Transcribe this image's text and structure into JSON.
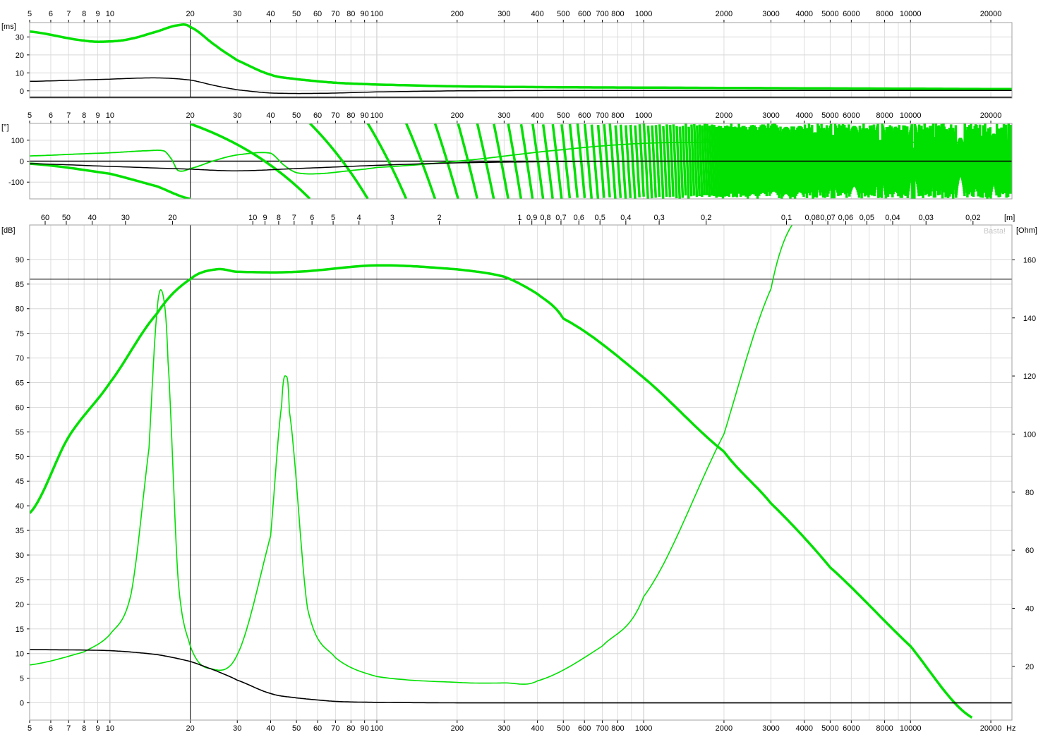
{
  "chart_data": [
    {
      "type": "line",
      "panel": "group-delay",
      "xscale": "log",
      "xlim": [
        5,
        24000
      ],
      "x_ticks": [
        "5",
        "6",
        "7",
        "8",
        "9",
        "10",
        "20",
        "30",
        "40",
        "50",
        "60",
        "70",
        "80",
        "90",
        "100",
        "200",
        "300",
        "400",
        "500",
        "600",
        "700",
        "800",
        "1000",
        "2000",
        "3000",
        "4000",
        "5000",
        "6000",
        "8000",
        "10000",
        "20000"
      ],
      "x_tick_values": [
        5,
        6,
        7,
        8,
        9,
        10,
        20,
        30,
        40,
        50,
        60,
        70,
        80,
        90,
        100,
        200,
        300,
        400,
        500,
        600,
        700,
        800,
        1000,
        2000,
        3000,
        4000,
        5000,
        6000,
        8000,
        10000,
        20000
      ],
      "unit": "[ms]",
      "ylim": [
        -4,
        38
      ],
      "y_ticks": [
        0,
        10,
        20,
        30
      ],
      "cursor_x": 20,
      "series": [
        {
          "style": "thick",
          "color": "#00e000",
          "x": [
            5,
            8,
            10,
            12,
            15,
            18,
            20,
            25,
            30,
            40,
            50,
            70,
            100,
            200,
            500,
            1000,
            3000,
            10000,
            24000
          ],
          "y": [
            33,
            28,
            27.5,
            29,
            33,
            36.5,
            35.5,
            25,
            17,
            9,
            6.5,
            4.5,
            3.5,
            2.5,
            2,
            1.8,
            1.5,
            1.2,
            1
          ]
        },
        {
          "style": "thin",
          "color": "#000000",
          "x": [
            5,
            10,
            15,
            20,
            25,
            30,
            40,
            60,
            100,
            200,
            500,
            24000
          ],
          "y": [
            5.3,
            6.5,
            7.2,
            6,
            2.8,
            0.6,
            -1.2,
            -1.4,
            -0.6,
            0,
            0.2,
            0.2
          ]
        }
      ]
    },
    {
      "type": "line",
      "panel": "phase",
      "xscale": "log",
      "xlim": [
        5,
        24000
      ],
      "x_ticks": [
        "5",
        "6",
        "7",
        "8",
        "9",
        "10",
        "20",
        "30",
        "40",
        "50",
        "60",
        "70",
        "80",
        "90",
        "100",
        "200",
        "300",
        "400",
        "500",
        "600",
        "700",
        "800",
        "1000",
        "2000",
        "3000",
        "4000",
        "5000",
        "6000",
        "8000",
        "10000",
        "20000"
      ],
      "x_tick_values": [
        5,
        6,
        7,
        8,
        9,
        10,
        20,
        30,
        40,
        50,
        60,
        70,
        80,
        90,
        100,
        200,
        300,
        400,
        500,
        600,
        700,
        800,
        1000,
        2000,
        3000,
        4000,
        5000,
        6000,
        8000,
        10000,
        20000
      ],
      "unit": "[°]",
      "ylim": [
        -180,
        180
      ],
      "y_ticks": [
        100,
        0,
        -100
      ],
      "cursor_x": 20,
      "series": [
        {
          "style": "thin",
          "color": "#00e000",
          "x": [
            5,
            8,
            10,
            14,
            16,
            17,
            18,
            20,
            25,
            30,
            40,
            45,
            50,
            60,
            80,
            100,
            200,
            500,
            1000,
            2000,
            24000
          ],
          "y": [
            25,
            35,
            40,
            50,
            48,
            10,
            -45,
            -35,
            5,
            30,
            38,
            -20,
            -55,
            -60,
            -45,
            -30,
            0,
            55,
            85,
            90,
            90
          ]
        },
        {
          "style": "thin",
          "color": "#000000",
          "x": [
            5,
            10,
            20,
            30,
            50,
            100,
            200,
            500,
            1000,
            24000
          ],
          "y": [
            -12,
            -25,
            -38,
            -46,
            -35,
            -20,
            -8,
            -2,
            0,
            0
          ]
        }
      ],
      "wrapped_phase": {
        "style": "thick",
        "color": "#00e000",
        "delay_ms": 0.0275,
        "phase_at_20hz": 178,
        "phase_below_cursor": [
          [
            5,
            -12
          ],
          [
            10,
            -60
          ],
          [
            15,
            -120
          ],
          [
            20,
            -180
          ]
        ]
      }
    },
    {
      "type": "line",
      "panel": "spl-impedance",
      "xscale": "log",
      "xlim": [
        5,
        24000
      ],
      "x_ticks": [
        "5",
        "6",
        "7",
        "8",
        "9",
        "10",
        "20",
        "30",
        "40",
        "50",
        "60",
        "70",
        "80",
        "90",
        "100",
        "200",
        "300",
        "400",
        "500",
        "600",
        "700",
        "800",
        "1000",
        "2000",
        "3000",
        "4000",
        "5000",
        "6000",
        "8000",
        "10000",
        "20000"
      ],
      "x_tick_values": [
        5,
        6,
        7,
        8,
        9,
        10,
        20,
        30,
        40,
        50,
        60,
        70,
        80,
        90,
        100,
        200,
        300,
        400,
        500,
        600,
        700,
        800,
        1000,
        2000,
        3000,
        4000,
        5000,
        6000,
        8000,
        10000,
        20000
      ],
      "x_unit": "Hz",
      "wavelength_unit": "[m]",
      "wavelength_ticks": [
        "60",
        "50",
        "40",
        "30",
        "20",
        "10",
        "9",
        "8",
        "7",
        "6",
        "5",
        "4",
        "3",
        "2",
        "1",
        "0,9",
        "0,8",
        "0,7",
        "0,6",
        "0,5",
        "0,4",
        "0,3",
        "0,2",
        "0,1",
        "0,08",
        "0,07",
        "0,06",
        "0,05",
        "0,04",
        "0,03",
        "0,02"
      ],
      "wavelength_tick_values": [
        60,
        50,
        40,
        30,
        20,
        10,
        9,
        8,
        7,
        6,
        5,
        4,
        3,
        2,
        1,
        0.9,
        0.8,
        0.7,
        0.6,
        0.5,
        0.4,
        0.3,
        0.2,
        0.1,
        0.08,
        0.07,
        0.06,
        0.05,
        0.04,
        0.03,
        0.02
      ],
      "ylabel_left": "[dB]",
      "ylim_left": [
        -3.5,
        97
      ],
      "y_ticks_left": [
        0,
        5,
        10,
        15,
        20,
        25,
        30,
        35,
        40,
        45,
        50,
        55,
        60,
        65,
        70,
        75,
        80,
        85,
        90
      ],
      "ylabel_right": "[Ohm]",
      "ylim_right": [
        1.5,
        172
      ],
      "y_ticks_right": [
        20,
        40,
        60,
        80,
        100,
        120,
        140,
        160
      ],
      "cursor_x": 20,
      "cursor_y": 86,
      "watermark": "Basta!",
      "series": [
        {
          "style": "thick",
          "color": "#00e000",
          "axis": "left",
          "x": [
            5,
            7,
            10,
            15,
            20,
            25,
            30,
            50,
            100,
            200,
            300,
            400,
            500,
            1000,
            2000,
            3000,
            5000,
            10000,
            17000
          ],
          "y": [
            38.5,
            54,
            65,
            79,
            86,
            88,
            87.5,
            87.5,
            88.8,
            88,
            86.5,
            83,
            78,
            66,
            51,
            40.5,
            27.5,
            11.5,
            -3
          ]
        },
        {
          "style": "thin",
          "color": "#00e000",
          "axis": "right",
          "x": [
            5,
            8,
            10,
            12,
            14,
            15,
            15.8,
            16.5,
            18,
            20,
            23,
            30,
            40,
            44,
            45.5,
            47,
            55,
            70,
            100,
            200,
            300,
            400,
            700,
            1000,
            2000,
            3000,
            3600
          ],
          "y": [
            20.5,
            25,
            31,
            45,
            95,
            142,
            148,
            125,
            50,
            27,
            19.5,
            24,
            65,
            110,
            120,
            108,
            40,
            23,
            16.5,
            14.5,
            14.3,
            15,
            27,
            44,
            100,
            150,
            172
          ]
        },
        {
          "style": "thin",
          "color": "#000000",
          "axis": "left",
          "x": [
            5,
            10,
            15,
            20,
            25,
            30,
            40,
            50,
            70,
            100,
            200,
            24000
          ],
          "y": [
            10.8,
            10.6,
            9.8,
            8.4,
            6.5,
            4.6,
            1.9,
            1,
            0.3,
            0.1,
            0,
            0
          ]
        }
      ]
    }
  ]
}
